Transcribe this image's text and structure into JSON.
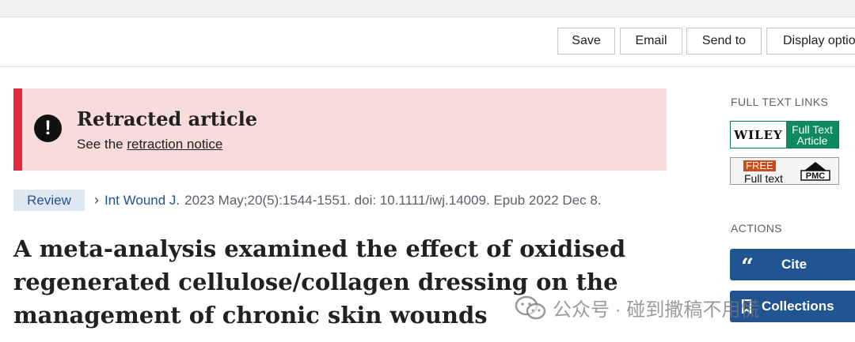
{
  "toolbar": {
    "save": "Save",
    "email": "Email",
    "send_to": "Send to",
    "display_options": "Display options"
  },
  "retraction": {
    "icon": "exclamation-circle-icon",
    "icon_glyph": "!",
    "title": "Retracted article",
    "prefix": "See the ",
    "link": "retraction notice"
  },
  "citation": {
    "badge": "Review",
    "chevron": "›",
    "journal": "Int Wound J.",
    "details": "2023 May;20(5):1544-1551. doi: 10.1111/iwj.14009. Epub 2022 Dec 8."
  },
  "article": {
    "title_lines": [
      "A meta-analysis examined the effect of oxidised",
      "regenerated cellulose/collagen dressing on the",
      "management of chronic skin wounds"
    ]
  },
  "sidebar": {
    "full_text_links_label": "FULL TEXT LINKS",
    "wiley": {
      "logo": "WILEY",
      "line1": "Full Text",
      "line2": "Article"
    },
    "pmc": {
      "free": "FREE",
      "full_text": "Full text",
      "logo": "PMC"
    },
    "actions_label": "ACTIONS",
    "cite": {
      "icon": "quote-icon",
      "glyph": "“",
      "label": "Cite"
    },
    "collections": {
      "icon": "bookmark-icon",
      "label": "Collections"
    }
  },
  "watermark": {
    "text": "公众号 · 碰到撒稿不用慌"
  },
  "colors": {
    "accent_blue": "#205493",
    "retraction_bg": "#f8dcdc",
    "retraction_border": "#e0283f",
    "wiley_green": "#0e8a63",
    "free_orange": "#cc4b1c"
  }
}
